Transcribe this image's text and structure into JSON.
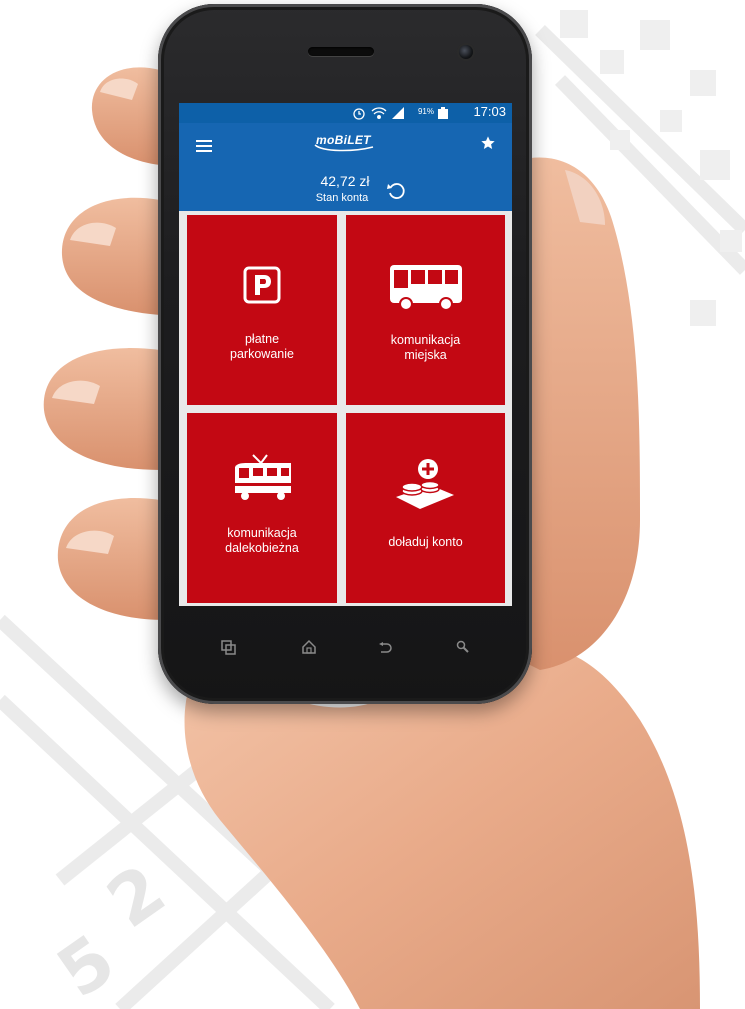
{
  "status_bar": {
    "battery_percent": "91%",
    "time": "17:03",
    "icons": [
      "alarm-icon",
      "wifi-icon",
      "signal-icon",
      "battery-icon"
    ]
  },
  "app_bar": {
    "logo": "moBiLET",
    "balance": "42,72 zł",
    "balance_caption": "Stan konta"
  },
  "tiles": [
    {
      "label_line1": "płatne",
      "label_line2": "parkowanie",
      "icon": "parking-icon"
    },
    {
      "label_line1": "komunikacja",
      "label_line2": "miejska",
      "icon": "bus-icon"
    },
    {
      "label_line1": "komunikacja",
      "label_line2": "dalekobieżna",
      "icon": "train-icon"
    },
    {
      "label_line1": "",
      "label_line2": "doładuj konto",
      "icon": "coins-topup-icon"
    }
  ],
  "nav_keys": [
    "recent-apps-icon",
    "home-icon",
    "back-icon",
    "search-icon"
  ],
  "colors": {
    "app_bar": "#1666b2",
    "status_bar": "#0d60a8",
    "tile": "#c30813",
    "grid_gap": "#e9e9e9"
  }
}
